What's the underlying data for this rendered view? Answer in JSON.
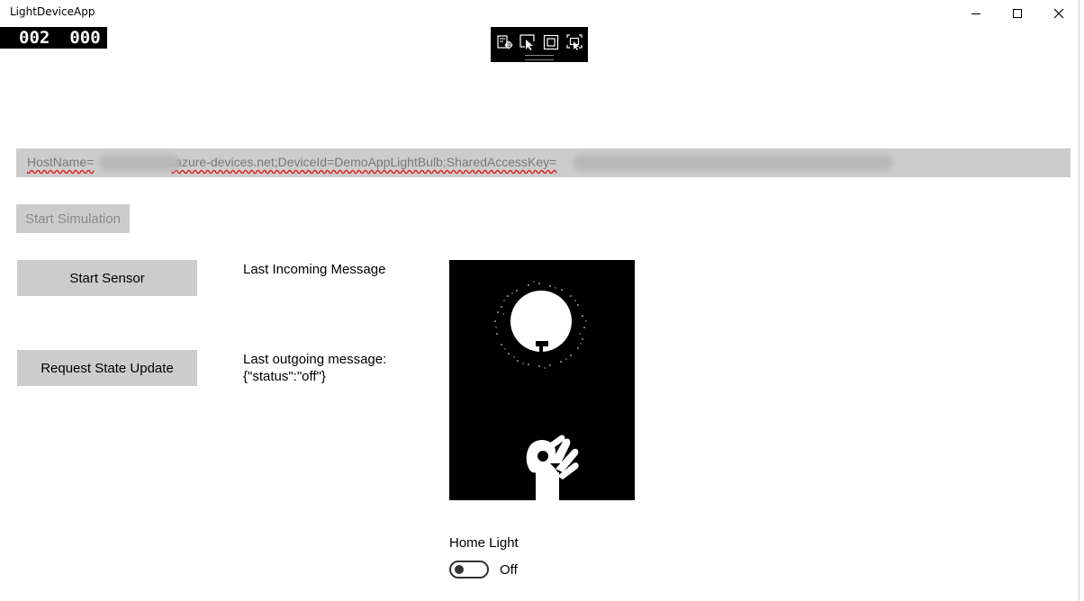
{
  "window": {
    "title": "LightDeviceApp",
    "minimize_icon": "minimize-icon",
    "maximize_icon": "maximize-icon",
    "close_icon": "close-icon"
  },
  "frame_counter": {
    "left": "002",
    "right": "000"
  },
  "debug_toolbar": {
    "icons": [
      "live-visual-tree-icon",
      "select-element-icon",
      "display-layout-adorners-icon",
      "track-focused-element-icon"
    ]
  },
  "connection": {
    "part1": "HostName=",
    "part2": ".azure-devices.net;DeviceId=DemoAppLightBulb;SharedAccessKey="
  },
  "buttons": {
    "start_simulation": "Start Simulation",
    "start_sensor": "Start Sensor",
    "request_state_update": "Request State Update"
  },
  "messages": {
    "incoming_label": "Last Incoming Message",
    "outgoing_label": "Last outgoing message:",
    "outgoing_value": "{\"status\":\"off\"}"
  },
  "home_light": {
    "label": "Home Light",
    "state": "Off",
    "on": false
  }
}
